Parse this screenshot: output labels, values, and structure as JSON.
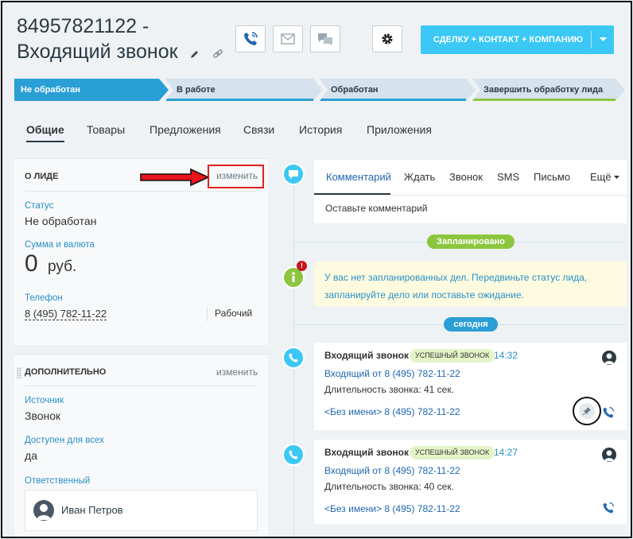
{
  "header": {
    "title_line1": "84957821122 -",
    "title_line2": "Входящий звонок",
    "main_button": "СДЕЛКУ + КОНТАКТ + КОМПАНИЮ",
    "accent": "#3bc8f5"
  },
  "stages": [
    {
      "label": "Не обработан",
      "color": "#2a9fd6"
    },
    {
      "label": "В работе",
      "color": "#d6e2ee"
    },
    {
      "label": "Обработан",
      "color": "#d6e2ee"
    },
    {
      "label": "Завершить обработку лида",
      "color": "#d6e2ee"
    }
  ],
  "tabs": [
    "Общие",
    "Товары",
    "Предложения",
    "Связи",
    "История",
    "Приложения"
  ],
  "about": {
    "title": "О ЛИДЕ",
    "edit": "изменить",
    "status_label": "Статус",
    "status_value": "Не обработан",
    "sum_label": "Сумма и валюта",
    "sum_value": "0",
    "currency": "руб.",
    "phone_label": "Телефон",
    "phone_value": "8 (495) 782-11-22",
    "phone_type": "Рабочий"
  },
  "extra": {
    "title": "ДОПОЛНИТЕЛЬНО",
    "edit": "изменить",
    "source_label": "Источник",
    "source_value": "Звонок",
    "public_label": "Доступен для всех",
    "public_value": "да",
    "responsible_label": "Ответственный",
    "responsible_value": "Иван Петров"
  },
  "composer": {
    "tabs": [
      "Комментарий",
      "Ждать",
      "Звонок",
      "SMS",
      "Письмо",
      "Ещё"
    ],
    "placeholder": "Оставьте комментарий"
  },
  "timeline": {
    "planned_label": "Запланировано",
    "planned_color": "#8cc63f",
    "notice_badge": "!",
    "notice_line1": "У вас нет запланированных дел. Передвиньте статус лида,",
    "notice_line2": "запланируйте дело или поставьте ожидание.",
    "today_label": "сегодня",
    "calls": [
      {
        "title": "Входящий звонок",
        "badge": "УСПЕШНЫЙ ЗВОНОК",
        "time": "14:32",
        "from": "Входящий от 8 (495) 782-11-22",
        "duration": "Длительность звонка: 41 сек.",
        "noname": "<Без имени> 8 (495) 782-11-22"
      },
      {
        "title": "Входящий звонок",
        "badge": "УСПЕШНЫЙ ЗВОНОК",
        "time": "14:27",
        "from": "Входящий от 8 (495) 782-11-22",
        "duration": "Длительность звонка: 40 сек.",
        "noname": "<Без имени> 8 (495) 782-11-22"
      }
    ]
  }
}
